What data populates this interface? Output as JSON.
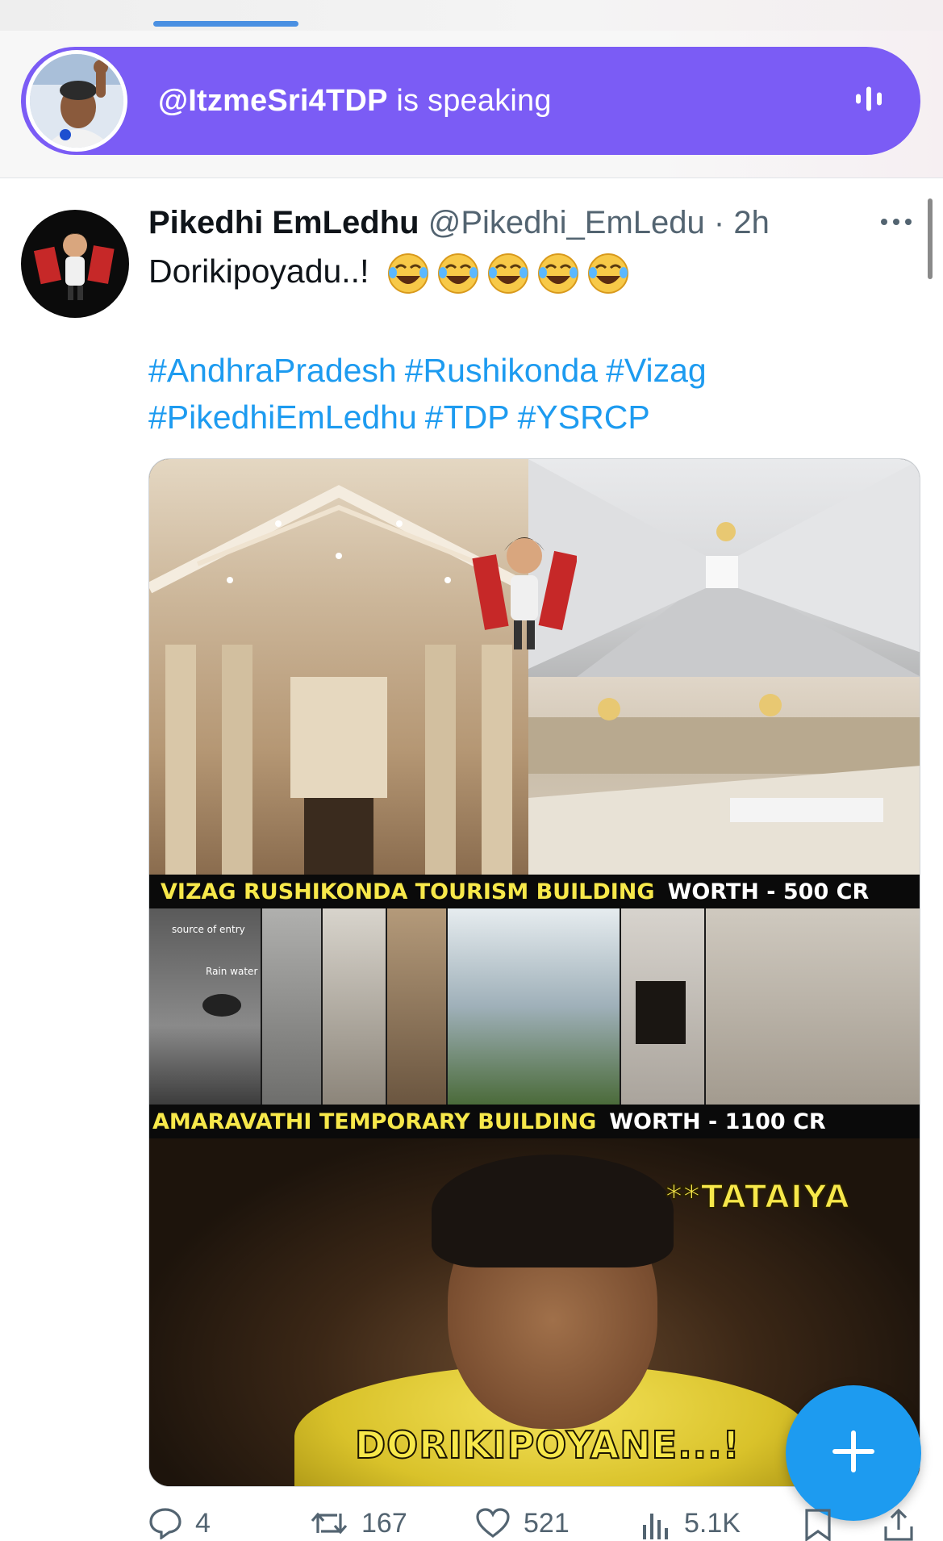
{
  "space": {
    "speaker_handle": "@ItzmeSri4TDP",
    "status_text": "is speaking",
    "bar_color": "#7b5cf5",
    "icons": {
      "avatar": "speaker-avatar",
      "audio": "equalizer-icon"
    }
  },
  "post": {
    "author_name": "Pikedhi EmLedhu",
    "author_handle": "@Pikedhi_EmLedu",
    "separator": "·",
    "time": "2h",
    "text": "Dorikipoyadu..!",
    "emoji": "face-with-tears-of-joy",
    "emoji_count": 5,
    "hashtags": [
      "#AndhraPradesh",
      "#Rushikonda",
      "#Vizag",
      "#PikedhiEmLedhu",
      "#TDP",
      "#YSRCP"
    ],
    "link_color": "#1d9bf0"
  },
  "media": {
    "caption1_yellow": "VIZAG RUSHIKONDA TOURISM BUILDING",
    "caption1_white": "WORTH - 500 CR",
    "caption2_yellow": "AMARAVATHI TEMPORARY BUILDING",
    "caption2_white": "WORTH - 1100 CR",
    "meme_top_text": "**TATAIYA",
    "meme_bottom_text": "DORIKIPOYANE...!",
    "photo_labels": [
      "source of entry",
      "Rain water"
    ]
  },
  "actions": {
    "replies": "4",
    "reposts": "167",
    "likes": "521",
    "views": "5.1K",
    "icons": [
      "reply-icon",
      "repost-icon",
      "like-icon",
      "views-icon",
      "bookmark-icon",
      "share-icon"
    ]
  },
  "fab": {
    "label": "+",
    "color": "#1d9bf0"
  }
}
